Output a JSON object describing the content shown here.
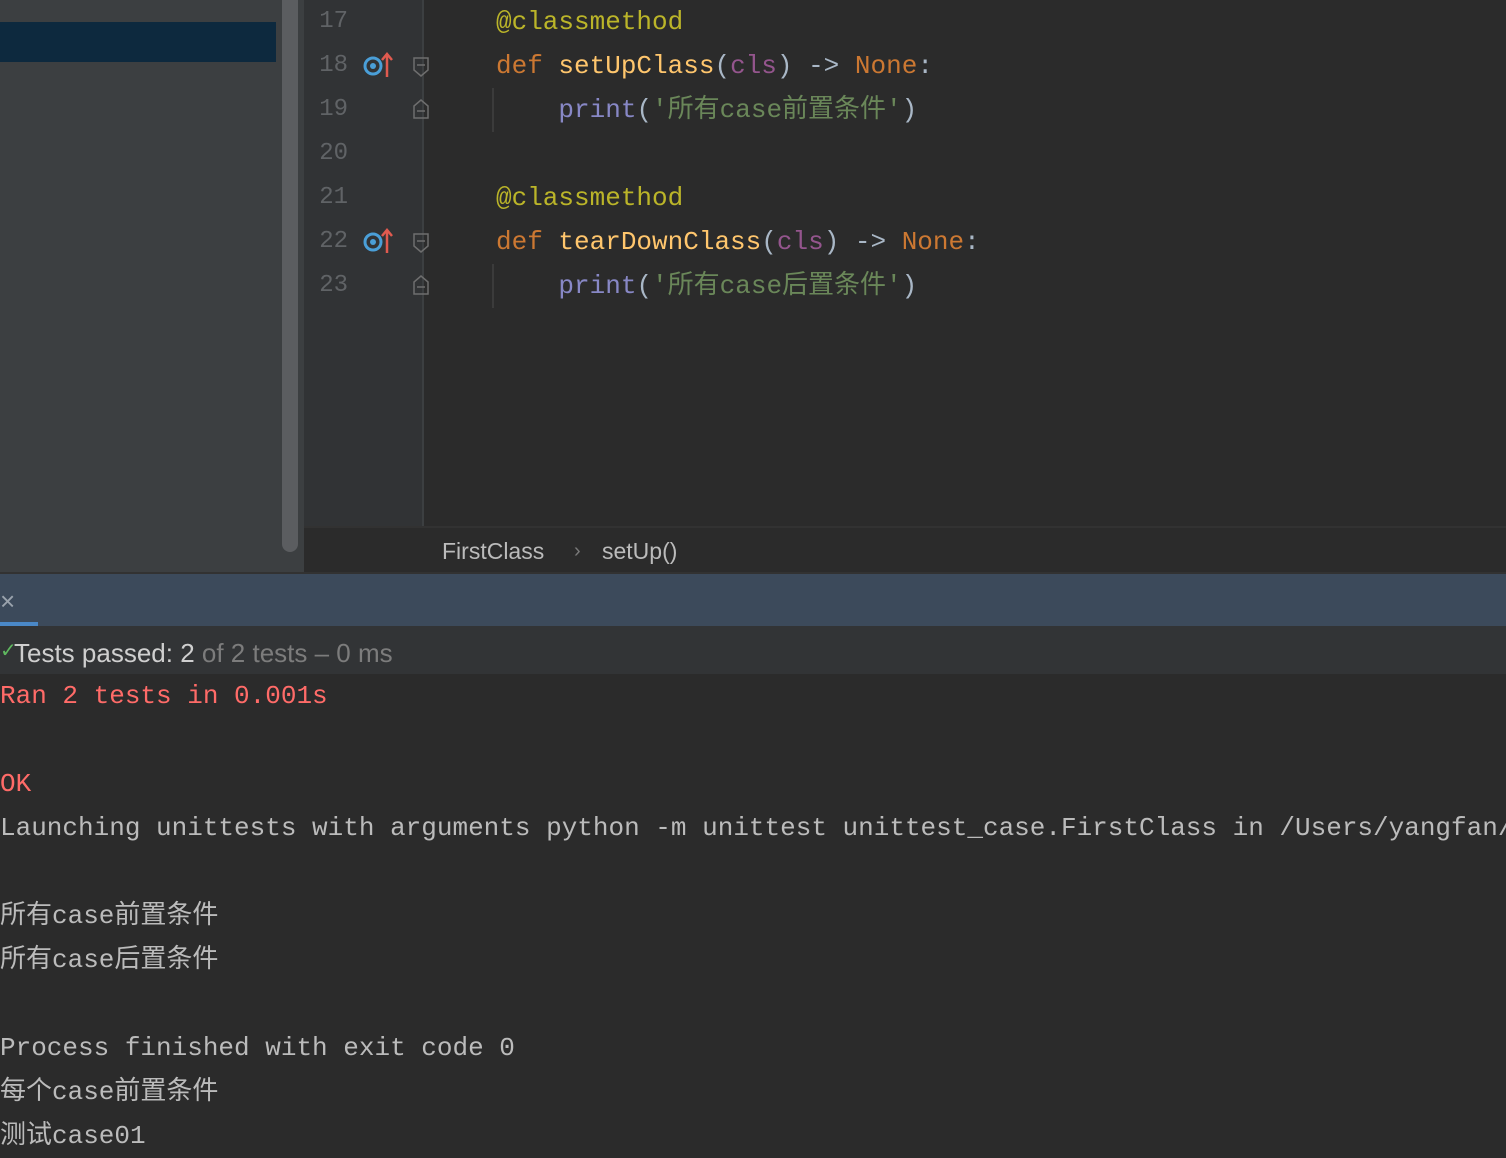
{
  "editor": {
    "lines": [
      {
        "num": "17",
        "tokens": [
          [
            "dec",
            "@classmethod"
          ]
        ]
      },
      {
        "num": "18",
        "tokens": [
          [
            "kw",
            "def "
          ],
          [
            "fn",
            "setUpClass"
          ],
          [
            "",
            "("
          ],
          [
            "par",
            "cls"
          ],
          [
            "",
            ") -> "
          ],
          [
            "kw",
            "None"
          ],
          [
            "",
            ":"
          ]
        ]
      },
      {
        "num": "19",
        "tokens": [
          [
            "",
            "    "
          ],
          [
            "bi",
            "print"
          ],
          [
            "",
            "("
          ],
          [
            "str",
            "'所有case前置条件'"
          ],
          [
            "",
            ")"
          ]
        ]
      },
      {
        "num": "20",
        "tokens": []
      },
      {
        "num": "21",
        "tokens": [
          [
            "dec",
            "@classmethod"
          ]
        ]
      },
      {
        "num": "22",
        "tokens": [
          [
            "kw",
            "def "
          ],
          [
            "fn",
            "tearDownClass"
          ],
          [
            "",
            "("
          ],
          [
            "par",
            "cls"
          ],
          [
            "",
            ") -> "
          ],
          [
            "kw",
            "None"
          ],
          [
            "",
            ":"
          ]
        ]
      },
      {
        "num": "23",
        "tokens": [
          [
            "",
            "    "
          ],
          [
            "bi",
            "print"
          ],
          [
            "",
            "("
          ],
          [
            "str",
            "'所有case后置条件'"
          ],
          [
            "",
            ")"
          ]
        ]
      }
    ]
  },
  "breadcrumb": {
    "class_name": "FirstClass",
    "separator": "›",
    "method_name": "setUp()"
  },
  "run": {
    "close_icon": "×",
    "status_check": "✓",
    "status_passed": "Tests passed: 2",
    "status_rest": " of 2 tests – 0 ms"
  },
  "console": {
    "lines": [
      {
        "text": "Ran 2 tests in 0.001s",
        "style": "err"
      },
      {
        "text": "",
        "style": "err"
      },
      {
        "text": "OK",
        "style": "err"
      },
      {
        "text": "Launching unittests with arguments python -m unittest unittest_case.FirstClass in /Users/yangfan/",
        "style": "normal"
      },
      {
        "text": "",
        "style": "normal"
      },
      {
        "text": "所有case前置条件",
        "style": "normal"
      },
      {
        "text": "所有case后置条件",
        "style": "normal"
      },
      {
        "text": "",
        "style": "normal"
      },
      {
        "text": "Process finished with exit code 0",
        "style": "normal"
      },
      {
        "text": "每个case前置条件",
        "style": "normal"
      },
      {
        "text": "测试case01",
        "style": "normal"
      }
    ]
  },
  "colors": {
    "overrides_icon": "#4a9fd8",
    "overrides_arrow": "#e05a4f",
    "error_text": "#ff6b68",
    "selection": "#0d293e"
  },
  "icons": [
    "override-method-icon",
    "fold-marker-icon",
    "close-icon",
    "check-icon",
    "chevron-right-icon"
  ]
}
